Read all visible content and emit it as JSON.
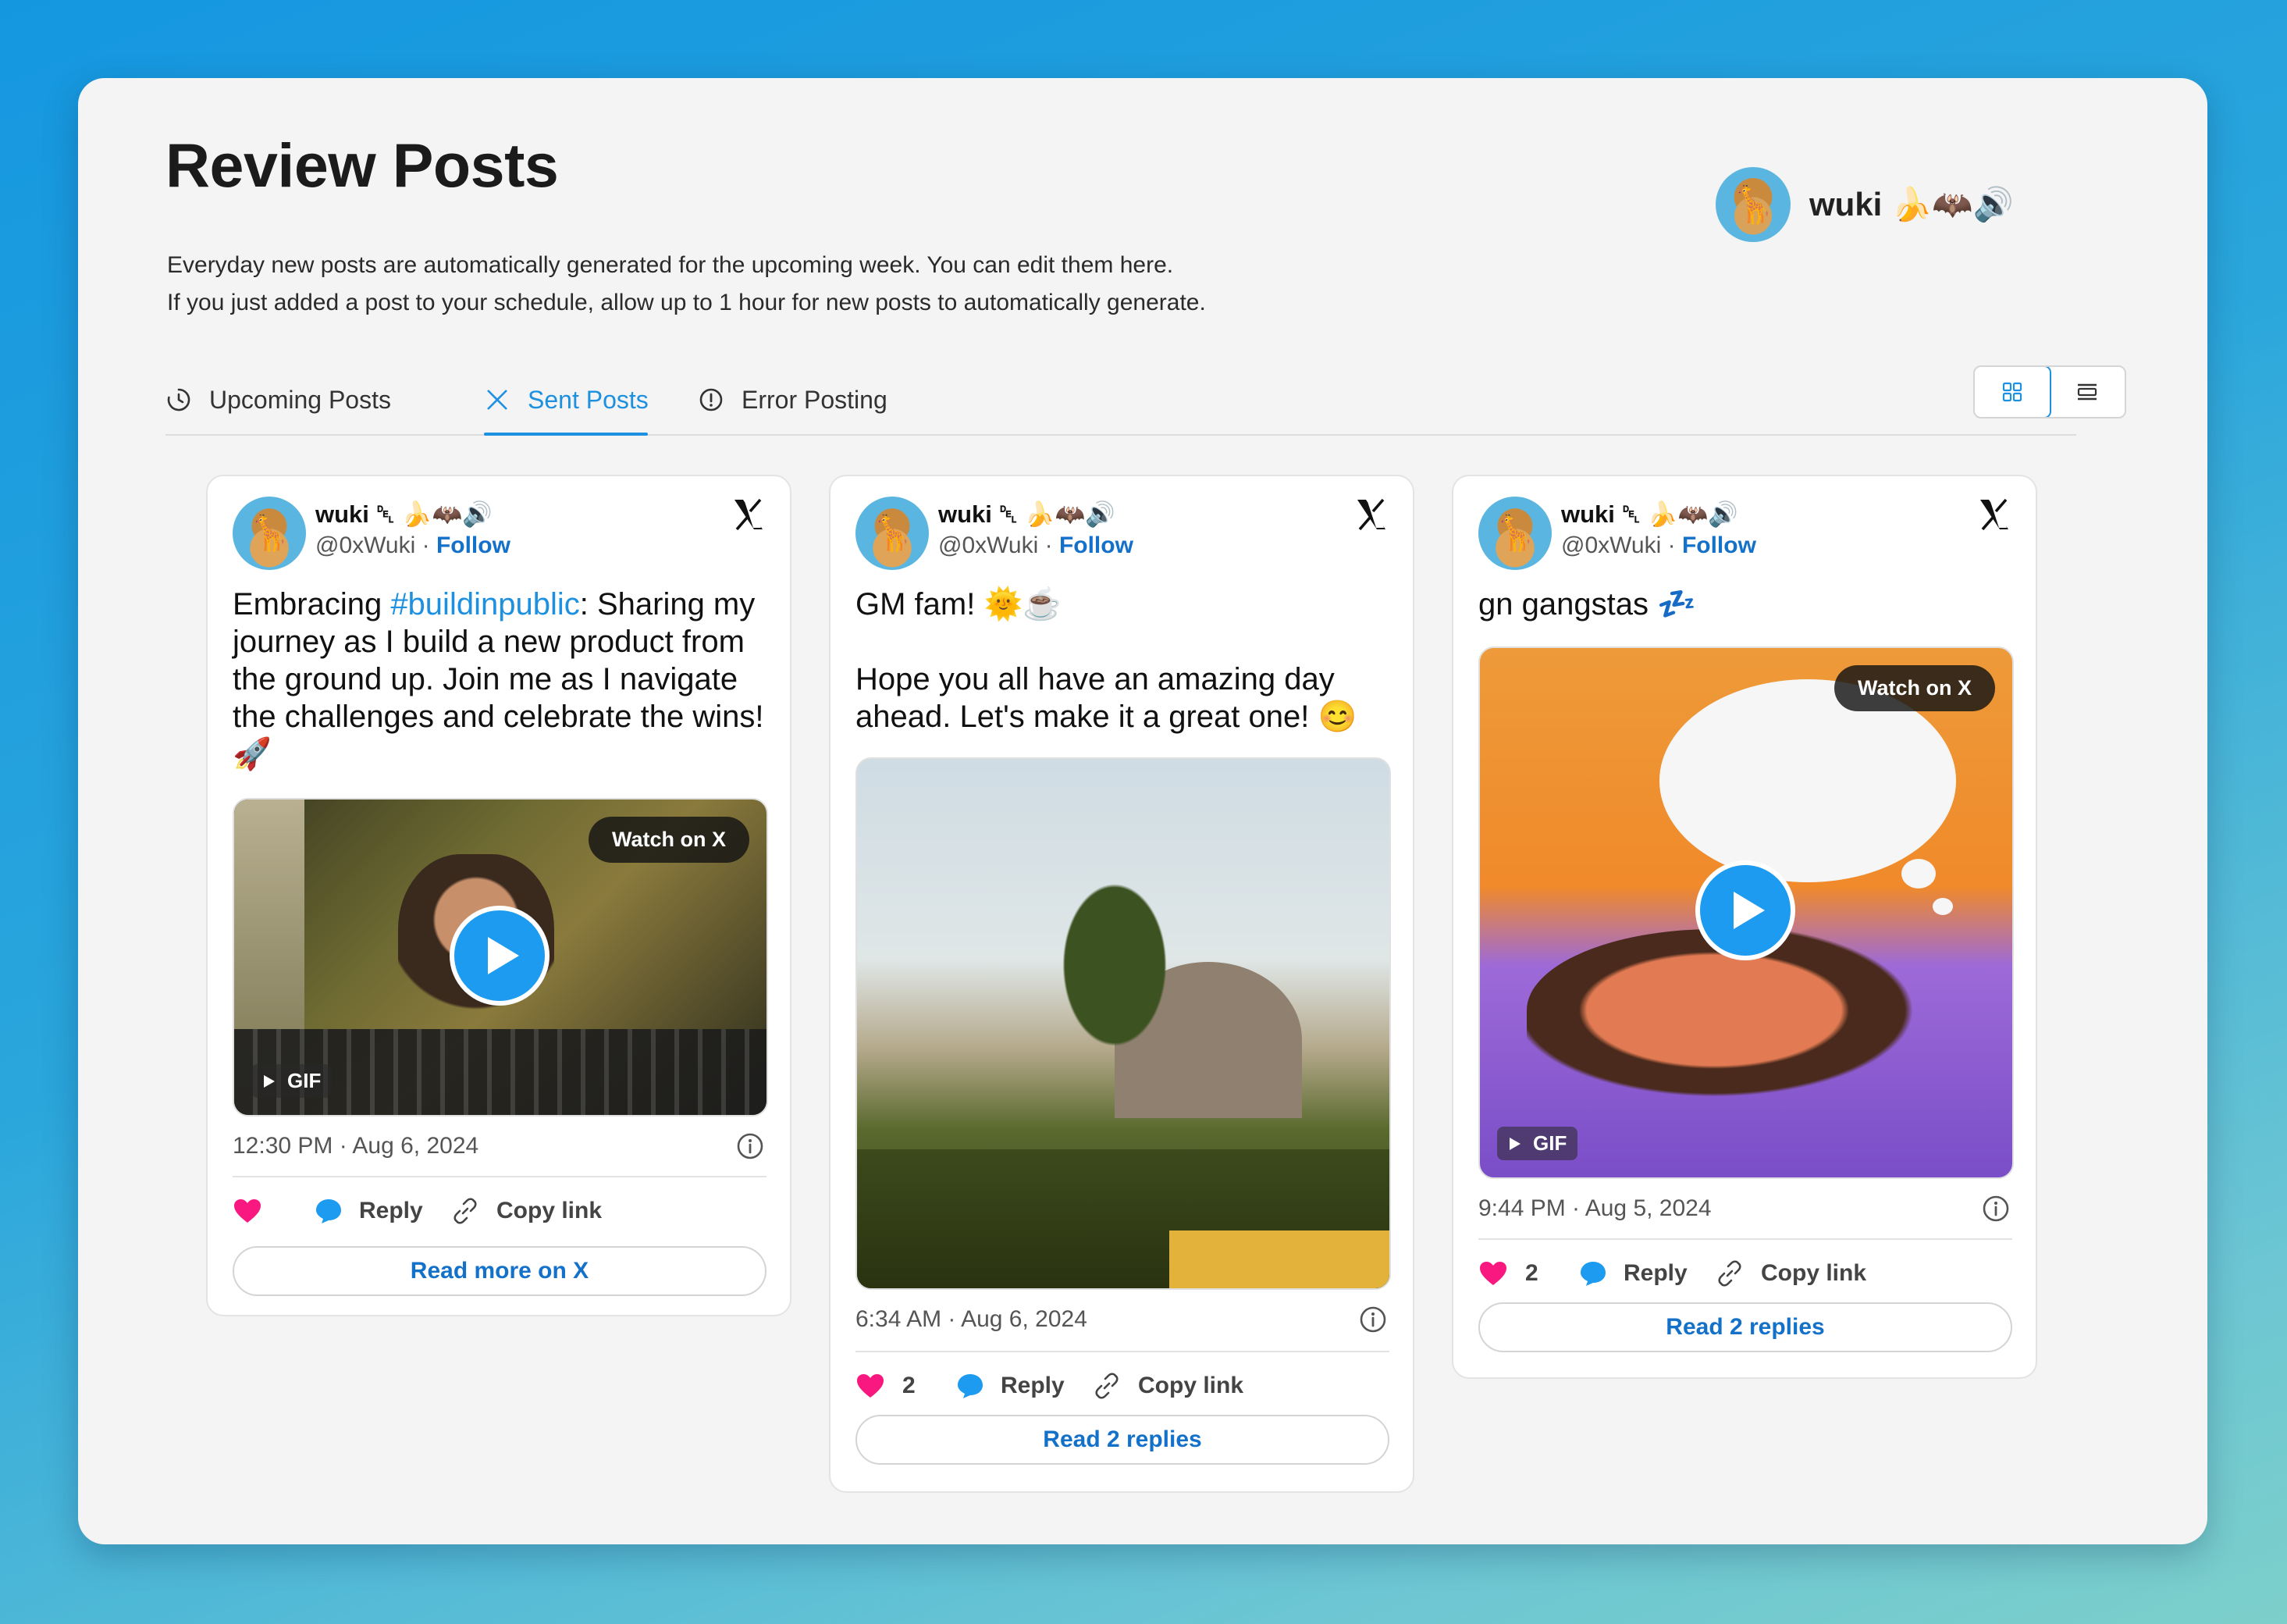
{
  "header": {
    "title": "Review Posts",
    "desc_line1": "Everyday new posts are automatically generated for the upcoming week. You can edit them here.",
    "desc_line2": "If you just added a post to your schedule, allow up to 1 hour for new posts to automatically generate."
  },
  "user": {
    "name": "wuki 🍌🦇🔊",
    "avatar": "🦒"
  },
  "tabs": [
    {
      "label": "Upcoming Posts",
      "icon": "clock-icon"
    },
    {
      "label": "Sent Posts",
      "icon": "x-logo-icon",
      "active": true
    },
    {
      "label": "Error Posting",
      "icon": "alert-circle-icon"
    }
  ],
  "view_toggle": {
    "options": [
      "grid-view-icon",
      "list-view-icon"
    ],
    "selected": "grid-view-icon"
  },
  "colors": {
    "accent": "#1d91e0",
    "link": "#1471c9",
    "heart": "#f91880",
    "play": "#1d9bf0"
  },
  "posts": [
    {
      "author": "wuki ␡ 🍌🦇🔊",
      "handle": "@0xWuki",
      "follow": "Follow",
      "text_before": "Embracing ",
      "hashtag": "#buildinpublic",
      "text_after": ": Sharing my journey as I build a new product from the ground up. Join me as I navigate the challenges and celebrate the wins! 🚀",
      "media": {
        "type": "gif",
        "watch": "Watch on X",
        "badge": "GIF"
      },
      "time": "12:30 PM · Aug 6, 2024",
      "likes": "",
      "reply": "Reply",
      "copy": "Copy link",
      "read": "Read more on X"
    },
    {
      "author": "wuki ␡ 🍌🦇🔊",
      "handle": "@0xWuki",
      "follow": "Follow",
      "text_l1": "GM fam! 🌞☕",
      "text_l2": "Hope you all have an amazing day ahead. Let's make it a great one! 😊",
      "media": {
        "type": "photo"
      },
      "time": "6:34 AM · Aug 6, 2024",
      "likes": "2",
      "reply": "Reply",
      "copy": "Copy link",
      "read": "Read 2 replies"
    },
    {
      "author": "wuki ␡ 🍌🦇🔊",
      "handle": "@0xWuki",
      "follow": "Follow",
      "text": "gn gangstas 💤",
      "media": {
        "type": "gif",
        "watch": "Watch on X",
        "badge": "GIF"
      },
      "time": "9:44 PM · Aug 5, 2024",
      "likes": "2",
      "reply": "Reply",
      "copy": "Copy link",
      "read": "Read 2 replies"
    }
  ]
}
